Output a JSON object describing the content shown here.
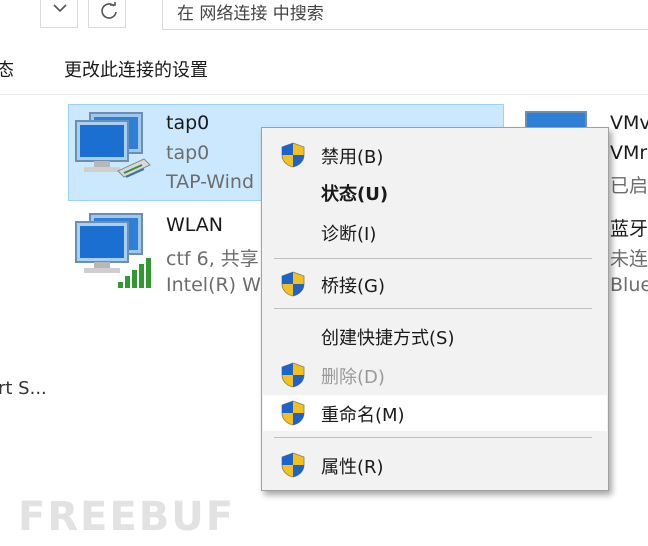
{
  "search": {
    "placeholder": "在 网络连接 中搜索"
  },
  "toolbar": {
    "left_cut": "态",
    "change_settings": "更改此连接的设置"
  },
  "adapters": [
    {
      "name": "tap0",
      "status": "tap0",
      "device": "TAP-Wind",
      "icon": "network-adapter-cable-icon",
      "selected": true
    },
    {
      "name": "WLAN",
      "status": "ctf 6, 共享",
      "device": "Intel(R) W",
      "icon": "network-adapter-wifi-icon",
      "selected": false
    },
    {
      "name": "VMv",
      "status": "VMr",
      "device": "已启",
      "icon": "network-adapter-icon",
      "selected": false
    },
    {
      "name": "蓝牙",
      "status": "未连",
      "device": "Blue",
      "icon": "network-adapter-icon",
      "selected": false
    }
  ],
  "left_item": {
    "label": "rt S..."
  },
  "context_menu": {
    "items": [
      {
        "label": "禁用(B)",
        "shield": true,
        "bold": false,
        "disabled": false
      },
      {
        "label": "状态(U)",
        "shield": false,
        "bold": true,
        "disabled": false
      },
      {
        "label": "诊断(I)",
        "shield": false,
        "bold": false,
        "disabled": false
      },
      {
        "label": "桥接(G)",
        "shield": true,
        "bold": false,
        "disabled": false
      },
      {
        "label": "创建快捷方式(S)",
        "shield": false,
        "bold": false,
        "disabled": false
      },
      {
        "label": "删除(D)",
        "shield": true,
        "bold": false,
        "disabled": true
      },
      {
        "label": "重命名(M)",
        "shield": true,
        "bold": false,
        "disabled": false,
        "highlighted": true
      },
      {
        "label": "属性(R)",
        "shield": true,
        "bold": false,
        "disabled": false
      }
    ]
  },
  "watermark": "FREEBUF",
  "colors": {
    "selection": "#cce8ff",
    "selection_border": "#99d1ff",
    "menu_bg": "#f2f2f2",
    "shield_blue": "#1e63c7",
    "shield_yellow": "#f4c01c"
  }
}
